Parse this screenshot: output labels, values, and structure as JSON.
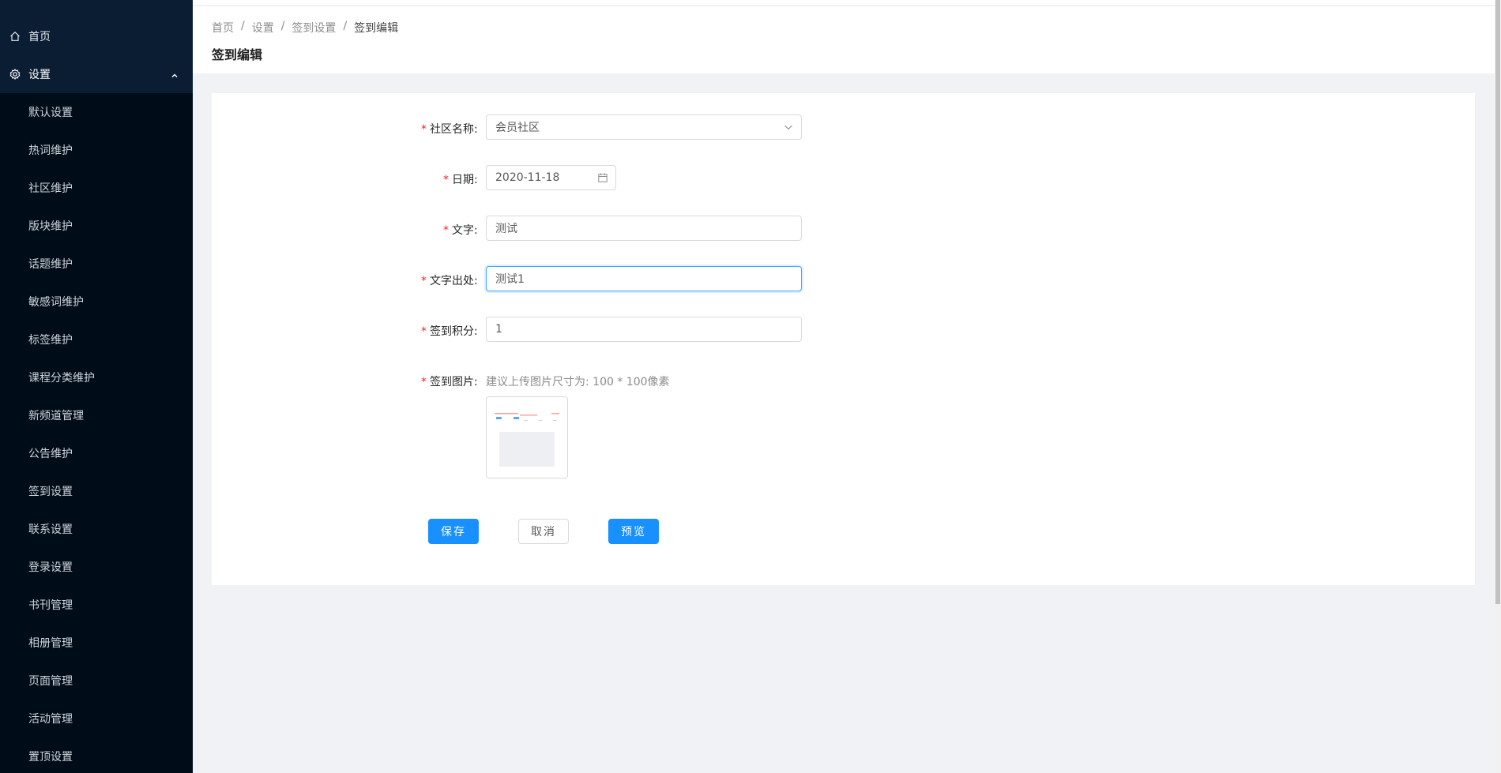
{
  "sidebar": {
    "home_label": "首页",
    "settings_label": "设置",
    "sub_items": [
      "默认设置",
      "热词维护",
      "社区维护",
      "版块维护",
      "话题维护",
      "敏感词维护",
      "标签维护",
      "课程分类维护",
      "新频道管理",
      "公告维护",
      "签到设置",
      "联系设置",
      "登录设置",
      "书刊管理",
      "相册管理",
      "页面管理",
      "活动管理",
      "置顶设置"
    ]
  },
  "breadcrumb": {
    "items": [
      "首页",
      "设置",
      "签到设置",
      "签到编辑"
    ],
    "separator": "/"
  },
  "page_title": "签到编辑",
  "form": {
    "required_mark": "*",
    "community": {
      "label": "社区名称:",
      "value": "会员社区"
    },
    "date": {
      "label": "日期:",
      "value": "2020-11-18"
    },
    "text": {
      "label": "文字:",
      "value": "测试"
    },
    "text_source": {
      "label": "文字出处:",
      "value": "测试1"
    },
    "points": {
      "label": "签到积分:",
      "value": "1"
    },
    "image": {
      "label": "签到图片:",
      "hint": "建议上传图片尺寸为: 100 * 100像素"
    }
  },
  "buttons": {
    "save": "保存",
    "cancel": "取消",
    "preview": "预览"
  },
  "colors": {
    "sidebar_bg": "#001529",
    "primary": "#1890ff",
    "required": "#f5222d"
  }
}
